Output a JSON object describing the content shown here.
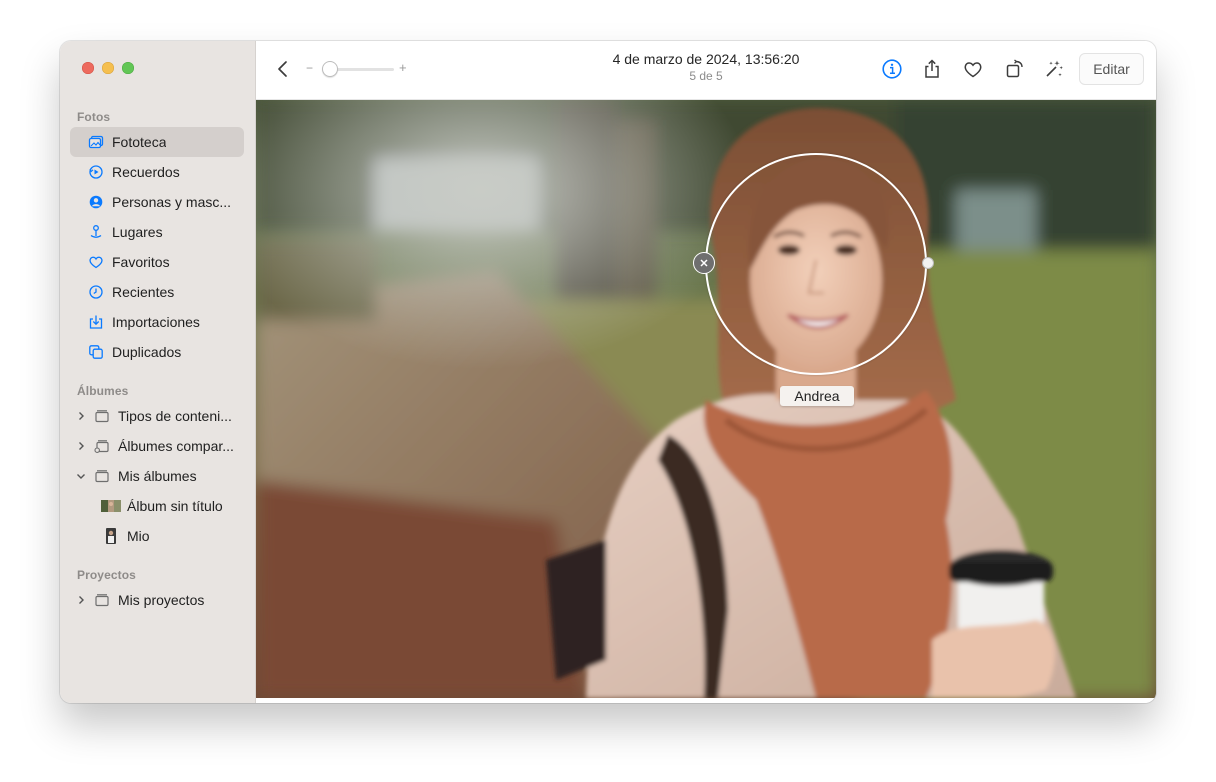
{
  "sidebar": {
    "sections": [
      {
        "label": "Fotos"
      },
      {
        "label": "Álbumes"
      },
      {
        "label": "Proyectos"
      }
    ],
    "fotos_items": [
      {
        "label": "Fototeca",
        "icon": "library-icon",
        "selected": true
      },
      {
        "label": "Recuerdos",
        "icon": "memories-icon"
      },
      {
        "label": "Personas y masc...",
        "icon": "people-icon"
      },
      {
        "label": "Lugares",
        "icon": "places-icon"
      },
      {
        "label": "Favoritos",
        "icon": "heart-icon"
      },
      {
        "label": "Recientes",
        "icon": "clock-icon"
      },
      {
        "label": "Importaciones",
        "icon": "import-icon"
      },
      {
        "label": "Duplicados",
        "icon": "duplicates-icon"
      }
    ],
    "album_items": [
      {
        "label": "Tipos de conteni...",
        "icon": "folder-icon",
        "expanded": false
      },
      {
        "label": "Álbumes compar...",
        "icon": "shared-folder-icon",
        "expanded": false
      },
      {
        "label": "Mis álbumes",
        "icon": "folder-icon",
        "expanded": true
      },
      {
        "label": "Álbum sin título",
        "icon": "album-thumbnail-icon"
      },
      {
        "label": "Mio",
        "icon": "album-thumbnail-icon"
      }
    ],
    "project_items": [
      {
        "label": "Mis proyectos",
        "icon": "folder-icon",
        "expanded": false
      }
    ]
  },
  "toolbar": {
    "title": "4 de marzo de 2024, 13:56:20",
    "subtitle": "5 de 5",
    "zoom_minus": "−",
    "zoom_plus": "+",
    "zoom_level": 0,
    "edit_label": "Editar"
  },
  "photo": {
    "face_name": "Andrea"
  },
  "colors": {
    "accent": "#0a7aff",
    "sidebar_bg": "#e8e4e1",
    "selected_bg": "#d4cfcc"
  }
}
